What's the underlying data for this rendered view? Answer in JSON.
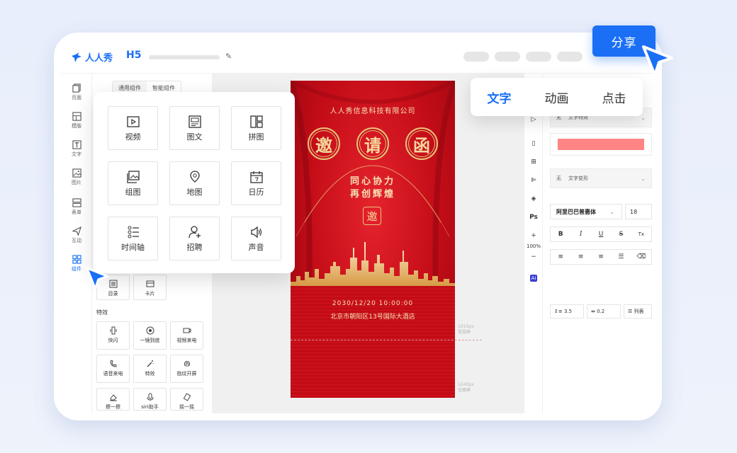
{
  "app": {
    "brand": "人人秀",
    "mode": "H5"
  },
  "share_label": "分享",
  "left_nav": [
    {
      "label": "页面",
      "icon": "pages-icon"
    },
    {
      "label": "模版",
      "icon": "template-icon"
    },
    {
      "label": "文字",
      "icon": "text-icon"
    },
    {
      "label": "图片",
      "icon": "image-icon"
    },
    {
      "label": "表单",
      "icon": "form-icon"
    },
    {
      "label": "互动",
      "icon": "interact-icon"
    },
    {
      "label": "组件",
      "icon": "component-icon",
      "active": true
    }
  ],
  "panel": {
    "tabs": [
      "通用组件",
      "智能组件"
    ],
    "partial_cards": [
      "目录",
      "卡片"
    ],
    "section_title": "特效",
    "effects": [
      "快闪",
      "一镜到底",
      "视频来电",
      "语音来电",
      "特效",
      "指纹开屏",
      "擦一擦",
      "siri助手",
      "摇一摇"
    ]
  },
  "component_popup": {
    "items": [
      "视频",
      "图文",
      "拼图",
      "组图",
      "地图",
      "日历",
      "时间轴",
      "招聘",
      "声音"
    ]
  },
  "poster": {
    "company": "人人秀信息科技有限公司",
    "title_chars": [
      "邀",
      "请",
      "函"
    ],
    "slogan_line1": "同心协力",
    "slogan_line2": "再创辉煌",
    "seal": "邀",
    "datetime": "2030/12/20 10:00:00",
    "address": "北京市朝阳区13号国际大酒店"
  },
  "guides": [
    {
      "line1": "1010px",
      "line2": "常规屏"
    },
    {
      "line1": "1240px",
      "line2": "全面屏"
    }
  ],
  "tool_strip": {
    "zoom": "100%",
    "ps_label": "Ps",
    "ai_label": "Ai"
  },
  "text_popup": {
    "tabs": [
      "文字",
      "动画",
      "点击"
    ],
    "active": "文字"
  },
  "right_panel": {
    "effect_select": {
      "prefix": "无",
      "label": "文字特效"
    },
    "fill_color": "#ff8585",
    "transform_select": {
      "prefix": "无",
      "label": "文字变形"
    },
    "font_family": "阿里巴巴普惠体",
    "font_size": "18",
    "style_buttons": [
      "B",
      "I",
      "U",
      "S",
      "Tx"
    ],
    "line_height": "3.5",
    "letter_spacing": "0.2",
    "list_label": "列表"
  },
  "colors": {
    "accent": "#1a6ff5",
    "poster_red": "#c40d18",
    "gold": "#e8c27b"
  }
}
